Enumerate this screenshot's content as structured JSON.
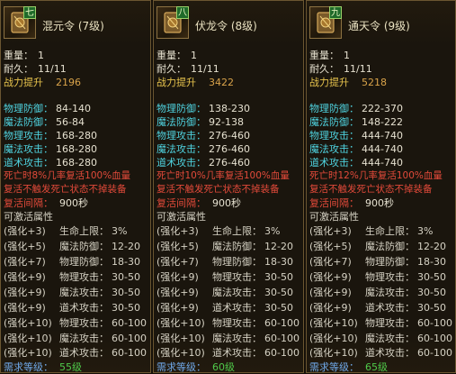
{
  "cards": [
    {
      "rank": "七",
      "name": "混元令 (7级)",
      "weight_label": "重量：",
      "weight": "1",
      "durability_label": "耐久：",
      "durability": "11/11",
      "power_label": "战力提升",
      "power": "2196",
      "stats": [
        {
          "label": "物理防御：",
          "value": "84-140"
        },
        {
          "label": "魔法防御：",
          "value": "56-84"
        },
        {
          "label": "物理攻击：",
          "value": "168-280"
        },
        {
          "label": "魔法攻击：",
          "value": "168-280"
        },
        {
          "label": "道术攻击：",
          "value": "168-280"
        }
      ],
      "special1": "死亡时8%几率复活100%血量",
      "special2": "复活不触发死亡状态不掉装备",
      "interval_label": "复活间隔：",
      "interval": "900秒",
      "activatable": "可激活属性",
      "enhance": [
        {
          "lv": "(强化+3)",
          "name": "生命上限：",
          "val": "3%"
        },
        {
          "lv": "(强化+5)",
          "name": "魔法防御：",
          "val": "12-20"
        },
        {
          "lv": "(强化+7)",
          "name": "物理防御：",
          "val": "18-30"
        },
        {
          "lv": "(强化+9)",
          "name": "物理攻击：",
          "val": "30-50"
        },
        {
          "lv": "(强化+9)",
          "name": "魔法攻击：",
          "val": "30-50"
        },
        {
          "lv": "(强化+9)",
          "name": "道术攻击：",
          "val": "30-50"
        },
        {
          "lv": "(强化+10)",
          "name": "物理攻击：",
          "val": "60-100"
        },
        {
          "lv": "(强化+10)",
          "name": "魔法攻击：",
          "val": "60-100"
        },
        {
          "lv": "(强化+10)",
          "name": "道术攻击：",
          "val": "60-100"
        }
      ],
      "req_label": "需求等级：",
      "req": "55级"
    },
    {
      "rank": "八",
      "name": "伏龙令 (8级)",
      "weight_label": "重量：",
      "weight": "1",
      "durability_label": "耐久：",
      "durability": "11/11",
      "power_label": "战力提升",
      "power": "3422",
      "stats": [
        {
          "label": "物理防御：",
          "value": "138-230"
        },
        {
          "label": "魔法防御：",
          "value": "92-138"
        },
        {
          "label": "物理攻击：",
          "value": "276-460"
        },
        {
          "label": "魔法攻击：",
          "value": "276-460"
        },
        {
          "label": "道术攻击：",
          "value": "276-460"
        }
      ],
      "special1": "死亡时10%几率复活100%血量",
      "special2": "复活不触发死亡状态不掉装备",
      "interval_label": "复活间隔：",
      "interval": "900秒",
      "activatable": "可激活属性",
      "enhance": [
        {
          "lv": "(强化+3)",
          "name": "生命上限：",
          "val": "3%"
        },
        {
          "lv": "(强化+5)",
          "name": "魔法防御：",
          "val": "12-20"
        },
        {
          "lv": "(强化+7)",
          "name": "物理防御：",
          "val": "18-30"
        },
        {
          "lv": "(强化+9)",
          "name": "物理攻击：",
          "val": "30-50"
        },
        {
          "lv": "(强化+9)",
          "name": "魔法攻击：",
          "val": "30-50"
        },
        {
          "lv": "(强化+9)",
          "name": "道术攻击：",
          "val": "30-50"
        },
        {
          "lv": "(强化+10)",
          "name": "物理攻击：",
          "val": "60-100"
        },
        {
          "lv": "(强化+10)",
          "name": "魔法攻击：",
          "val": "60-100"
        },
        {
          "lv": "(强化+10)",
          "name": "道术攻击：",
          "val": "60-100"
        }
      ],
      "req_label": "需求等级：",
      "req": "60级"
    },
    {
      "rank": "九",
      "name": "通天令 (9级)",
      "weight_label": "重量：",
      "weight": "1",
      "durability_label": "耐久：",
      "durability": "11/11",
      "power_label": "战力提升",
      "power": "5218",
      "stats": [
        {
          "label": "物理防御：",
          "value": "222-370"
        },
        {
          "label": "魔法防御：",
          "value": "148-222"
        },
        {
          "label": "物理攻击：",
          "value": "444-740"
        },
        {
          "label": "魔法攻击：",
          "value": "444-740"
        },
        {
          "label": "道术攻击：",
          "value": "444-740"
        }
      ],
      "special1": "死亡时12%几率复活100%血量",
      "special2": "复活不触发死亡状态不掉装备",
      "interval_label": "复活间隔：",
      "interval": "900秒",
      "activatable": "可激活属性",
      "enhance": [
        {
          "lv": "(强化+3)",
          "name": "生命上限：",
          "val": "3%"
        },
        {
          "lv": "(强化+5)",
          "name": "魔法防御：",
          "val": "12-20"
        },
        {
          "lv": "(强化+7)",
          "name": "物理防御：",
          "val": "18-30"
        },
        {
          "lv": "(强化+9)",
          "name": "物理攻击：",
          "val": "30-50"
        },
        {
          "lv": "(强化+9)",
          "name": "魔法攻击：",
          "val": "30-50"
        },
        {
          "lv": "(强化+9)",
          "name": "道术攻击：",
          "val": "30-50"
        },
        {
          "lv": "(强化+10)",
          "name": "物理攻击：",
          "val": "60-100"
        },
        {
          "lv": "(强化+10)",
          "name": "魔法攻击：",
          "val": "60-100"
        },
        {
          "lv": "(强化+10)",
          "name": "道术攻击：",
          "val": "60-100"
        }
      ],
      "req_label": "需求等级：",
      "req": "65级"
    }
  ]
}
